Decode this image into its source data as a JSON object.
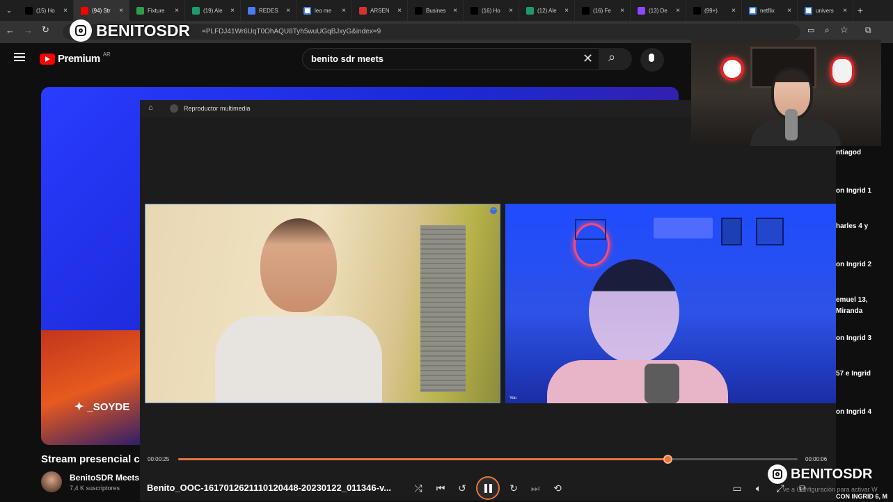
{
  "browser": {
    "tabs": [
      {
        "title": "(15) Ho",
        "icon": "x-logo-icon",
        "color": "#000000"
      },
      {
        "title": "(94) Str",
        "icon": "youtube-icon",
        "color": "#ff0000",
        "active": true
      },
      {
        "title": "Fixture",
        "icon": "fixture-icon",
        "color": "#2e9e4a"
      },
      {
        "title": "(19) Ale",
        "icon": "sheets-icon",
        "color": "#1c9c6b"
      },
      {
        "title": "REDES",
        "icon": "docs-icon",
        "color": "#4a7bf5"
      },
      {
        "title": "leo me",
        "icon": "google-icon",
        "color": "#ffffff"
      },
      {
        "title": "ARSEN",
        "icon": "bs-icon",
        "color": "#d43232"
      },
      {
        "title": "Busines",
        "icon": "tiktok-icon",
        "color": "#000000"
      },
      {
        "title": "(16) Ho",
        "icon": "x-logo-icon",
        "color": "#000000"
      },
      {
        "title": "(12) Ale",
        "icon": "sheets-icon",
        "color": "#1c9c6b"
      },
      {
        "title": "(16) Fe",
        "icon": "x-logo-icon",
        "color": "#000000"
      },
      {
        "title": "(13) De",
        "icon": "twitch-icon",
        "color": "#9146ff"
      },
      {
        "title": "(99+)",
        "icon": "tiktok-icon",
        "color": "#000000"
      },
      {
        "title": "netflix",
        "icon": "google-icon",
        "color": "#ffffff"
      },
      {
        "title": "univers",
        "icon": "google-icon",
        "color": "#ffffff"
      }
    ],
    "url": "=PLFDJ41Wr6UqT0OhAQU8Tyh5wuUGqBJxyG&index=9"
  },
  "overlay": {
    "instagram_handle_top": "BENITOSDR",
    "instagram_handle_bottom": "BENITOSDR"
  },
  "youtube": {
    "logo_text": "Premium",
    "region": "AR",
    "search_query": "benito sdr meets",
    "video_title": "Stream presencial c",
    "channel_name": "BenitoSDR Meets",
    "subscribers": "7,4 K suscriptores",
    "video_overlay_handle": "_SOYDE",
    "side_list": [
      "ntiagod",
      "on Ingrid 1",
      "harles 4 y",
      "on Ingrid 2",
      "emuel 13,",
      "Miranda",
      "on Ingrid 3",
      "57 e Ingrid",
      "on Ingrid 4",
      "CON INGRID 6, M"
    ],
    "activation_watermark": "ve a Configuración para activar W"
  },
  "media_player": {
    "app_title": "Reproductor multimedia",
    "current_time": "00:00:25",
    "total_time": "00:00:06",
    "progress": 0.79,
    "filename": "Benito_OOC-1617012621110120448-20230122_011346-v...",
    "left_cam_label": "",
    "right_cam_label": "You",
    "accent": "#e8743b"
  }
}
